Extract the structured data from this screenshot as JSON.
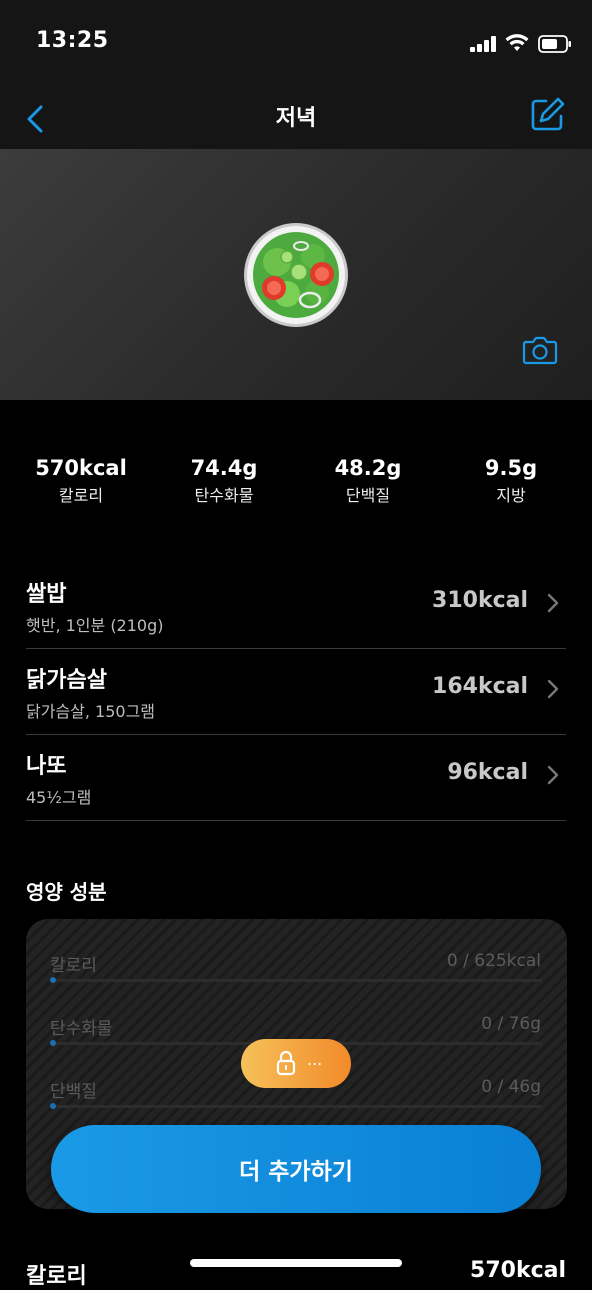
{
  "status": {
    "time": "13:25"
  },
  "nav": {
    "title": "저녁"
  },
  "macros": [
    {
      "value": "570kcal",
      "label": "칼로리"
    },
    {
      "value": "74.4g",
      "label": "탄수화물"
    },
    {
      "value": "48.2g",
      "label": "단백질"
    },
    {
      "value": "9.5g",
      "label": "지방"
    }
  ],
  "foods": [
    {
      "name": "쌀밥",
      "desc": "햇반, 1인분 (210g)",
      "kcal": "310kcal"
    },
    {
      "name": "닭가슴살",
      "desc": "닭가슴살, 150그램",
      "kcal": "164kcal"
    },
    {
      "name": "나또",
      "desc": "45½그램",
      "kcal": "96kcal"
    }
  ],
  "nutrition": {
    "title": "영양 성분",
    "items": [
      {
        "label": "칼로리",
        "value": "0 / 625kcal"
      },
      {
        "label": "탄수화물",
        "value": "0 / 76g"
      },
      {
        "label": "단백질",
        "value": "0 / 46g"
      }
    ],
    "unlock_text": "..."
  },
  "add_button": "더 추가하기",
  "summary": {
    "label": "칼로리",
    "value": "570kcal"
  },
  "colors": {
    "accent": "#1a9ae6",
    "unlock_start": "#f6c159",
    "unlock_end": "#f28a2a"
  }
}
